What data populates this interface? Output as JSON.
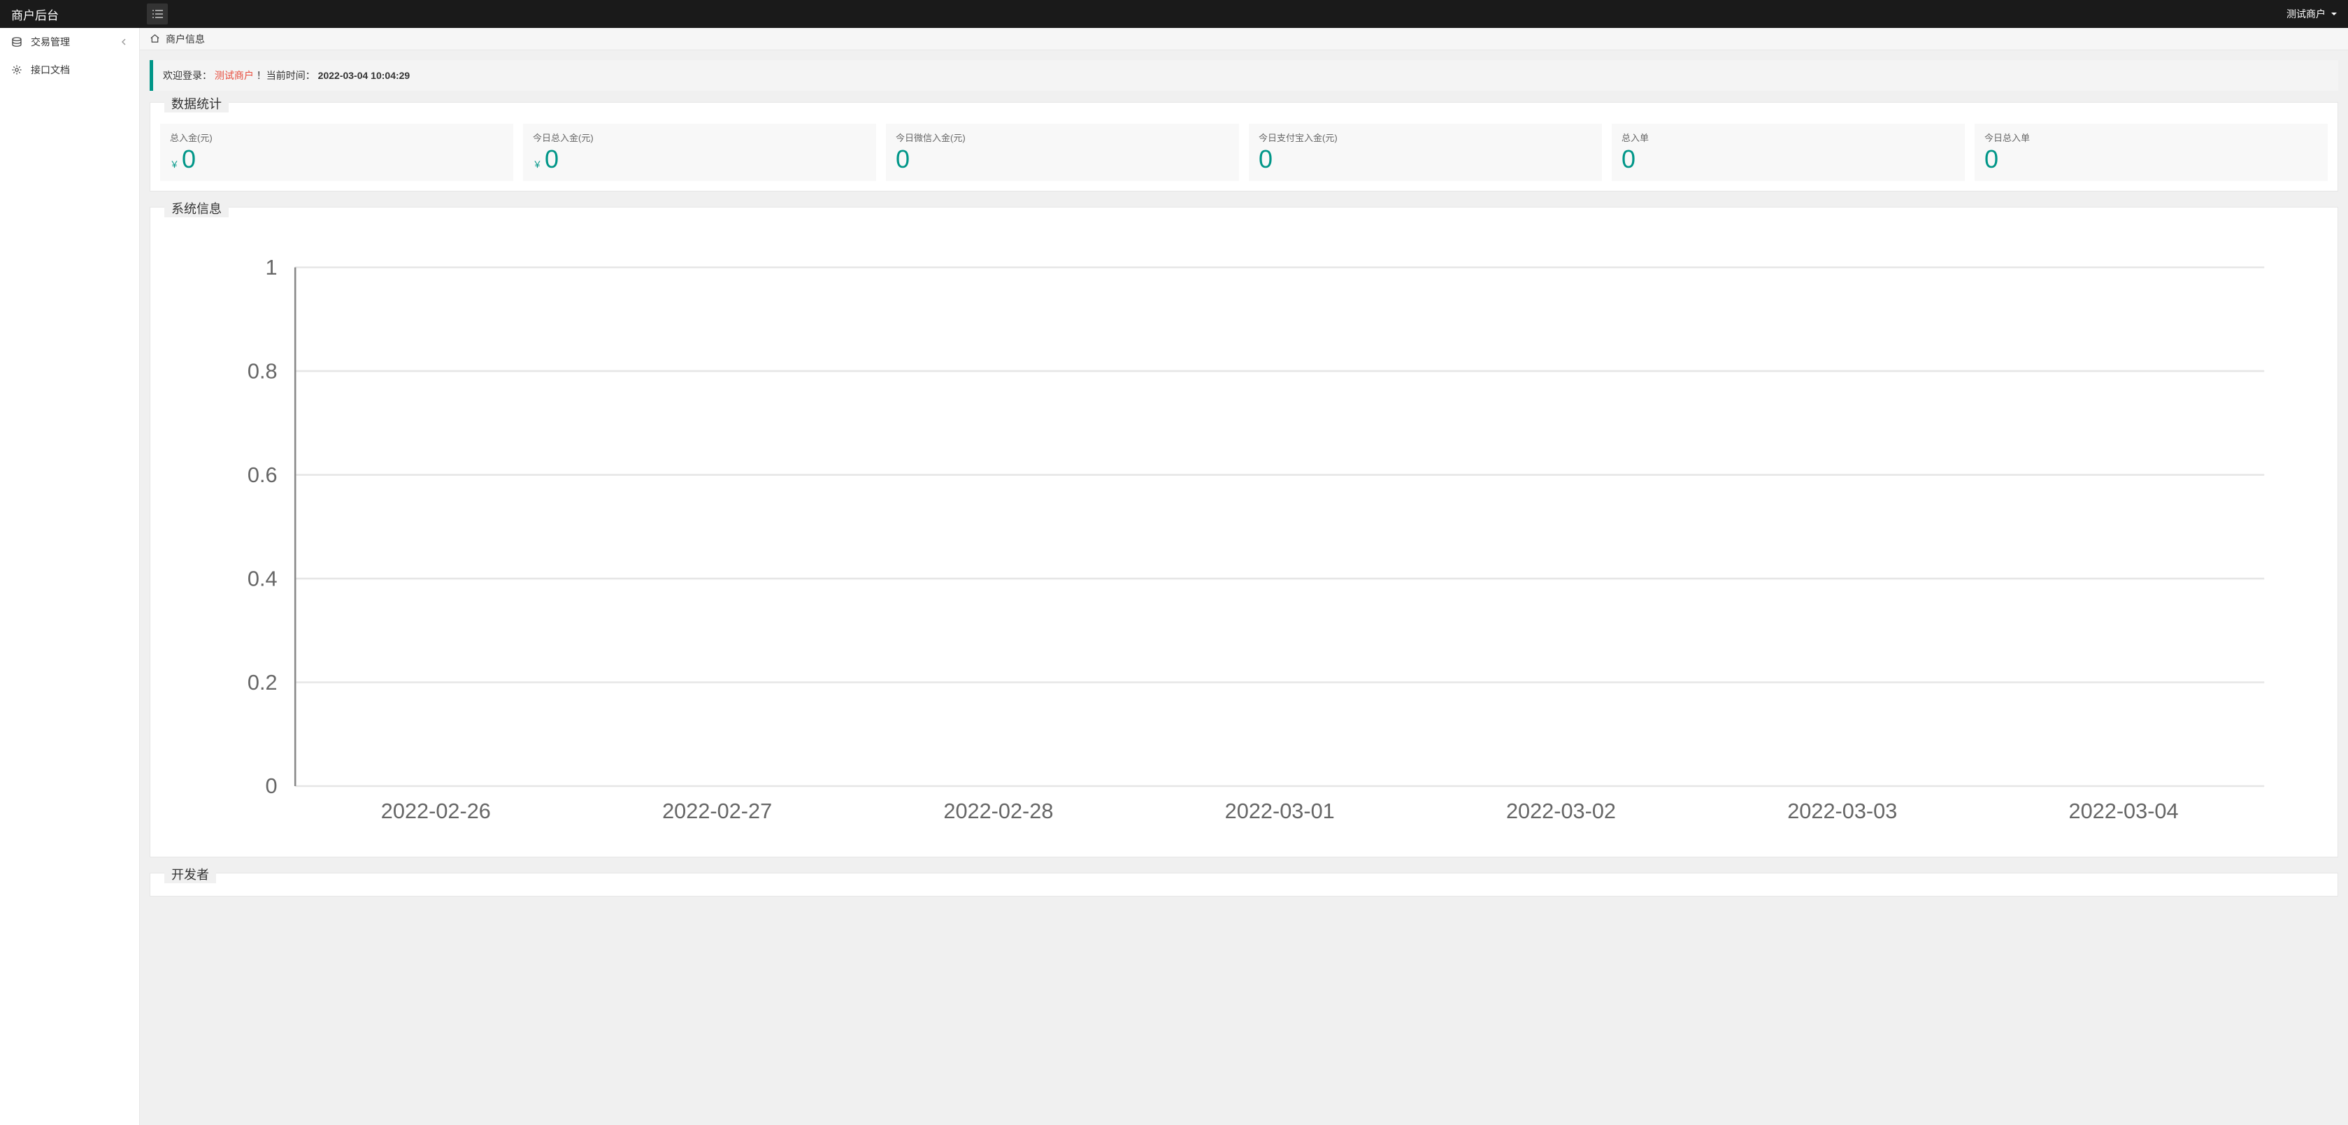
{
  "header": {
    "app_title": "商户后台",
    "user_name": "测试商户"
  },
  "sidebar": {
    "items": [
      {
        "label": "交易管理",
        "expandable": true
      },
      {
        "label": "接口文档",
        "expandable": false
      }
    ]
  },
  "breadcrumb": {
    "title": "商户信息"
  },
  "welcome": {
    "prefix": "欢迎登录：",
    "merchant_name": "测试商户",
    "suffix": "！当前时间：",
    "time": "2022-03-04 10:04:29"
  },
  "panels": {
    "stats_title": "数据统计",
    "system_title": "系统信息",
    "developer_title": "开发者"
  },
  "stats": {
    "currency_sign": "￥",
    "cards": [
      {
        "title": "总入金(元)",
        "value": "0",
        "has_currency": true
      },
      {
        "title": "今日总入金(元)",
        "value": "0",
        "has_currency": true
      },
      {
        "title": "今日微信入金(元)",
        "value": "0",
        "has_currency": false
      },
      {
        "title": "今日支付宝入金(元)",
        "value": "0",
        "has_currency": false
      },
      {
        "title": "总入单",
        "value": "0",
        "has_currency": false
      },
      {
        "title": "今日总入单",
        "value": "0",
        "has_currency": false
      }
    ]
  },
  "chart_data": {
    "type": "line",
    "title": "",
    "xlabel": "",
    "ylabel": "",
    "categories": [
      "2022-02-26",
      "2022-02-27",
      "2022-02-28",
      "2022-03-01",
      "2022-03-02",
      "2022-03-03",
      "2022-03-04"
    ],
    "y_ticks": [
      0,
      0.2,
      0.4,
      0.6,
      0.8,
      1
    ],
    "ylim": [
      0,
      1
    ],
    "series": []
  }
}
